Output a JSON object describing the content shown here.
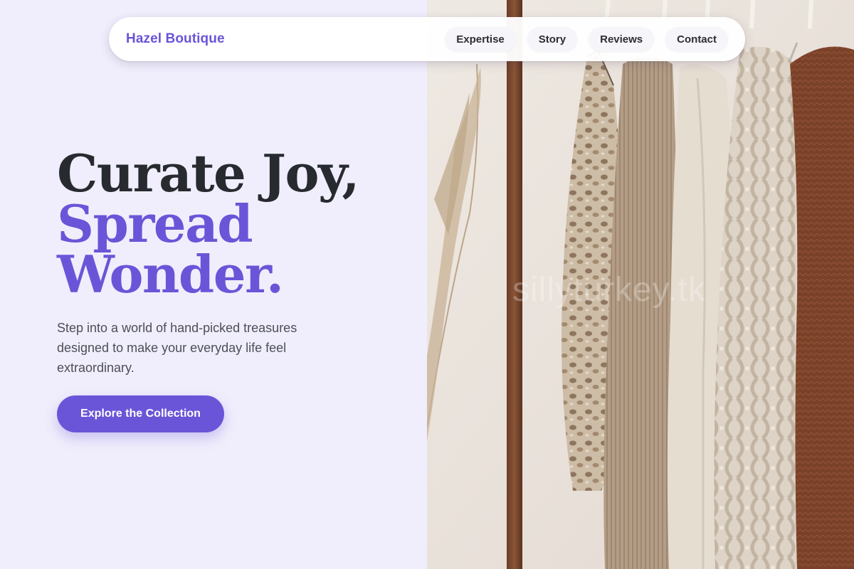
{
  "brand": {
    "name": "Hazel Boutique"
  },
  "nav": {
    "links": [
      "Expertise",
      "Story",
      "Reviews",
      "Contact"
    ]
  },
  "hero": {
    "title_line1": "Curate Joy,",
    "title_line2": "Spread",
    "title_line3": "Wonder.",
    "subtitle": "Step into a world of hand-picked treasures designed to make your everyday life feel extraordinary.",
    "cta_label": "Explore the Collection"
  },
  "photo": {
    "watermark": "sillyturkey.tk"
  },
  "colors": {
    "accent": "#6a55d8",
    "background": "#f0eefc",
    "text_dark": "#272a2f",
    "text_muted": "#4c4f57"
  }
}
